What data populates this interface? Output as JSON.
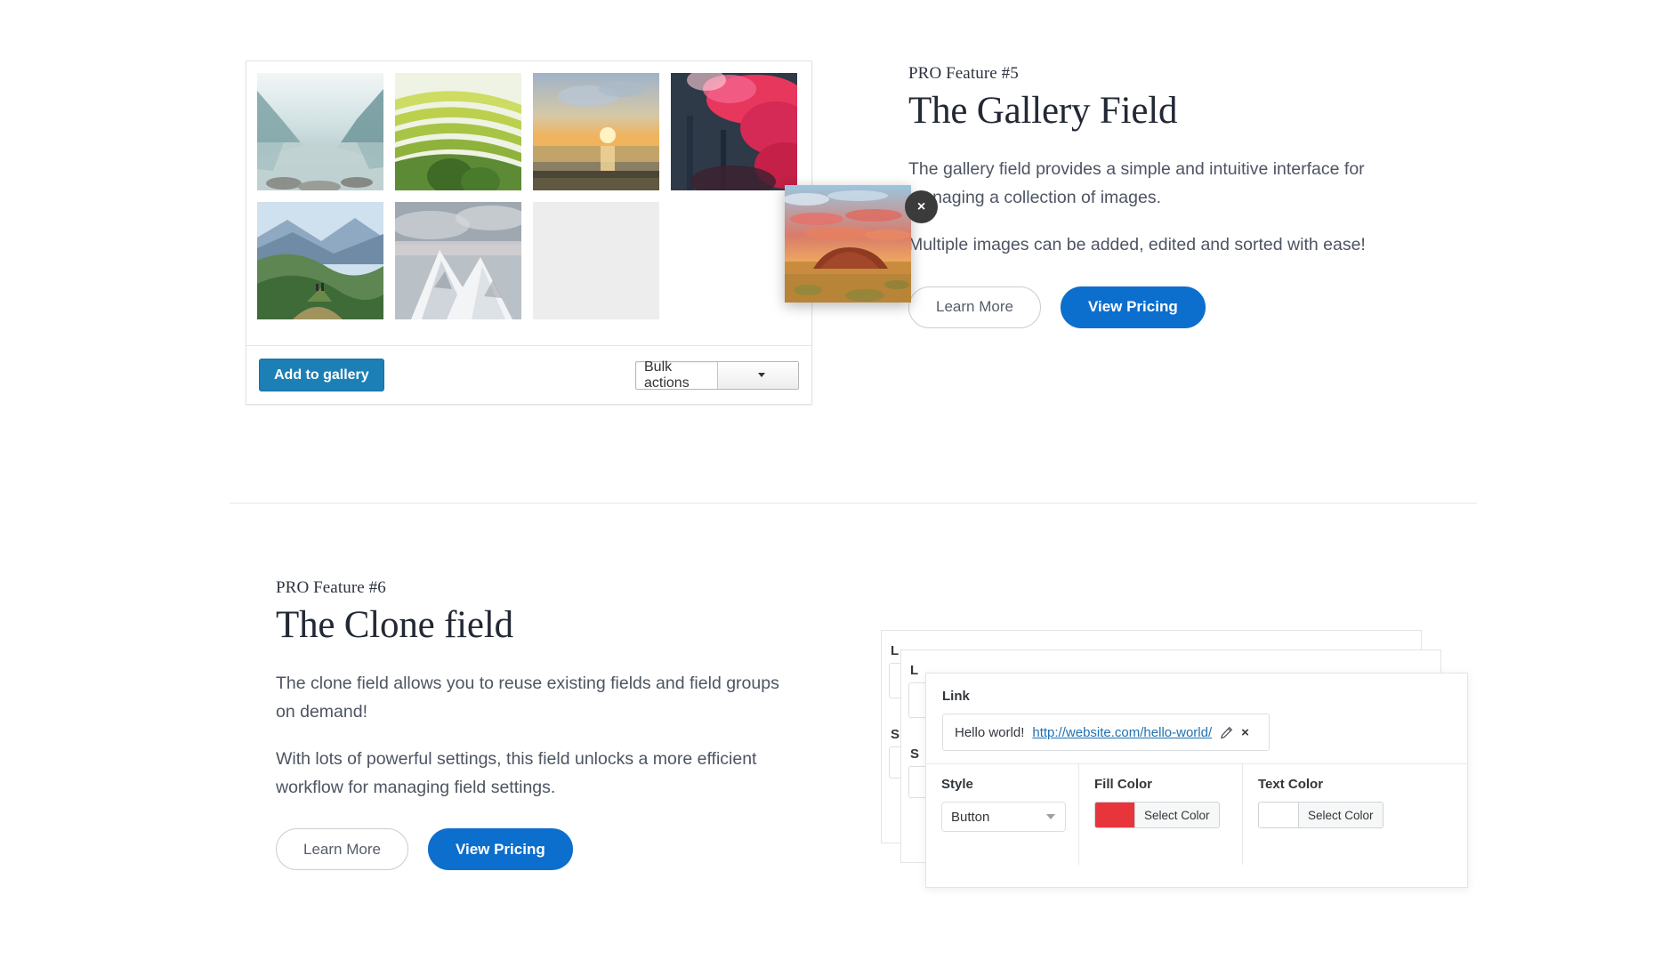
{
  "sections": [
    {
      "eyebrow": "PRO Feature #5",
      "title": "The Gallery Field",
      "paragraphs": [
        "The gallery field provides a simple and intuitive interface for managing a collection of images.",
        "Multiple images can be added, edited and sorted with ease!"
      ],
      "buttons": {
        "secondary": "Learn More",
        "primary": "View Pricing"
      }
    },
    {
      "eyebrow": "PRO Feature #6",
      "title": "The Clone field",
      "paragraphs": [
        "The clone field allows you to reuse existing fields and field groups on demand!",
        "With lots of powerful settings, this field unlocks a more efficient workflow for managing field settings."
      ],
      "buttons": {
        "secondary": "Learn More",
        "primary": "View Pricing"
      }
    }
  ],
  "gallery_widget": {
    "thumbnails": [
      {
        "alt": "mountain-lake-reflection"
      },
      {
        "alt": "green-terraced-hills"
      },
      {
        "alt": "ocean-sunset"
      },
      {
        "alt": "red-foliage-forest"
      },
      {
        "alt": "hikers-on-green-ridge"
      },
      {
        "alt": "snowy-mountain-peaks"
      },
      {
        "alt": "empty-drop-slot"
      }
    ],
    "dragged_thumbnail": {
      "alt": "uluru-red-rock-sunset"
    },
    "close_icon": "×",
    "add_button": "Add to gallery",
    "bulk_select": {
      "value": "Bulk actions"
    }
  },
  "clone_widget": {
    "ghost_labels": {
      "link": "L",
      "style": "S"
    },
    "link_field": {
      "label": "Link",
      "title": "Hello world!",
      "url": "http://website.com/hello-world/",
      "edit_icon": "pencil-icon",
      "remove_icon": "×"
    },
    "style_field": {
      "label": "Style",
      "value": "Button"
    },
    "fill_color": {
      "label": "Fill Color",
      "button": "Select Color",
      "swatch": "#e8353b"
    },
    "text_color": {
      "label": "Text Color",
      "button": "Select Color",
      "swatch": "#ffffff"
    }
  },
  "colors": {
    "primary_blue": "#0c6ecd",
    "wp_blue": "#1c7fb5",
    "link_blue": "#2271b1",
    "heading": "#222834",
    "body_text": "#4d5562",
    "divider": "#e7e9eb"
  }
}
